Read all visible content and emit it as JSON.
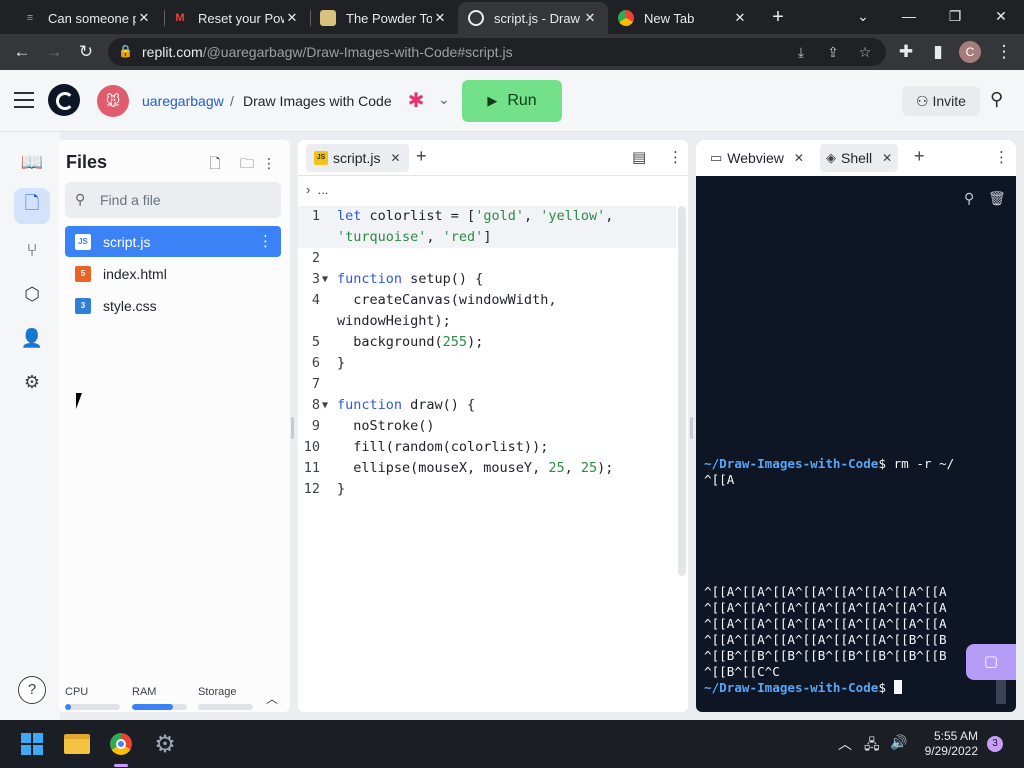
{
  "browser": {
    "tabs": [
      {
        "title": "Can someone pl",
        "close": "✕"
      },
      {
        "title": "Reset your Pow",
        "close": "✕"
      },
      {
        "title": "The Powder Toy",
        "close": "✕"
      },
      {
        "title": "script.js - Draw I",
        "close": "✕"
      },
      {
        "title": "New Tab",
        "close": "✕"
      }
    ],
    "url_prefix": "replit.com",
    "url_rest": "/@uaregarbagw/Draw-Images-with-Code#script.js",
    "profile_initial": "C"
  },
  "header": {
    "owner": "uaregarbagw",
    "separator": "/",
    "repl_name": "Draw Images with Code",
    "run_label": "Run",
    "invite_label": "Invite"
  },
  "files": {
    "title": "Files",
    "search_placeholder": "Find a file",
    "items": [
      {
        "name": "script.js",
        "type": "js"
      },
      {
        "name": "index.html",
        "type": "html"
      },
      {
        "name": "style.css",
        "type": "css"
      }
    ],
    "usage": {
      "cpu_label": "CPU",
      "ram_label": "RAM",
      "storage_label": "Storage",
      "cpu": 0.1,
      "ram": 0.75,
      "storage": 0.0
    }
  },
  "editor": {
    "tab_label": "script.js",
    "breadcrumb": "...",
    "lines": [
      {
        "n": "1",
        "fold": "",
        "html": "<span class=\"kw\">let</span> colorlist = [<span class=\"str\">'gold'</span>, <span class=\"str\">'yellow'</span>,"
      },
      {
        "n": "",
        "fold": "",
        "html": "<span class=\"str\">'turquoise'</span>, <span class=\"str\">'red'</span>]"
      },
      {
        "n": "2",
        "fold": "",
        "html": ""
      },
      {
        "n": "3",
        "fold": "▼",
        "html": "<span class=\"kw\">function</span> setup() {"
      },
      {
        "n": "4",
        "fold": "",
        "html": "  createCanvas(windowWidth,"
      },
      {
        "n": "",
        "fold": "",
        "html": "windowHeight);"
      },
      {
        "n": "5",
        "fold": "",
        "html": "  background(<span class=\"num\">255</span>);"
      },
      {
        "n": "6",
        "fold": "",
        "html": "}"
      },
      {
        "n": "7",
        "fold": "",
        "html": ""
      },
      {
        "n": "8",
        "fold": "▼",
        "html": "<span class=\"kw\">function</span> draw() {"
      },
      {
        "n": "9",
        "fold": "",
        "html": "  noStroke()"
      },
      {
        "n": "10",
        "fold": "",
        "html": "  fill(random(colorlist));"
      },
      {
        "n": "11",
        "fold": "",
        "html": "  ellipse(mouseX, mouseY, <span class=\"num\">25</span>, <span class=\"num\">25</span>);"
      },
      {
        "n": "12",
        "fold": "",
        "html": "}"
      }
    ]
  },
  "shell": {
    "webview_label": "Webview",
    "shell_label": "Shell",
    "prompt_path": "~/Draw-Images-with-Code",
    "prompt_char": "$",
    "command1": " rm -r ~/",
    "output1": "^[[A",
    "output2": [
      "^[[A^[[A^[[A^[[A^[[A^[[A^[[A^[[A",
      "^[[A^[[A^[[A^[[A^[[A^[[A^[[A^[[A",
      "^[[A^[[A^[[A^[[A^[[A^[[A^[[A^[[A",
      "^[[A^[[A^[[A^[[A^[[A^[[A^[[B^[[B",
      "^[[B^[[B^[[B^[[B^[[B^[[B^[[B^[[B",
      "^[[B^[[C^C"
    ]
  },
  "taskbar": {
    "time": "5:55 AM",
    "date": "9/29/2022",
    "notifications": "3"
  }
}
